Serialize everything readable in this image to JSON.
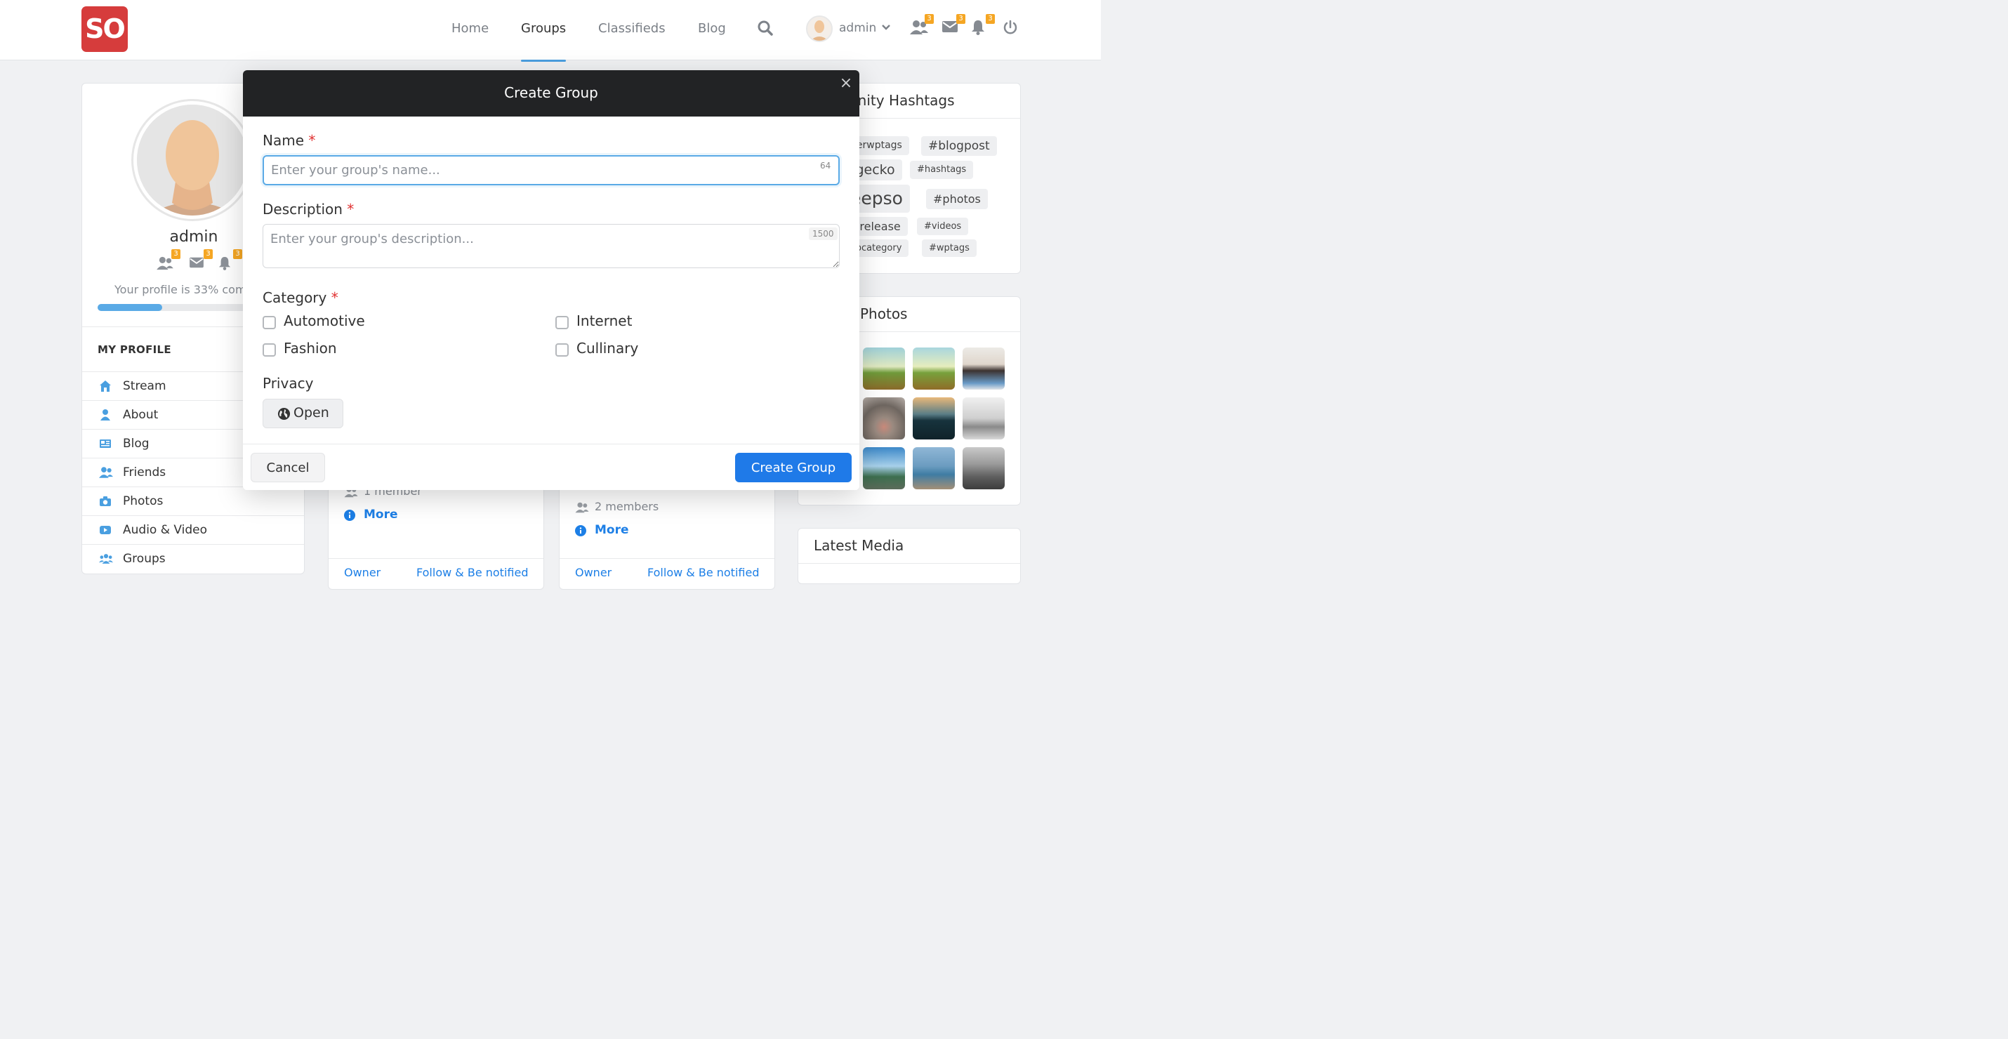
{
  "header": {
    "logo_text": "SO",
    "nav": [
      "Home",
      "Groups",
      "Classifieds",
      "Blog"
    ],
    "active_nav": "Groups",
    "username": "admin",
    "badges": {
      "friends": "3",
      "messages": "3",
      "notifications": "3"
    }
  },
  "profile": {
    "name": "admin",
    "badges": {
      "friends": "3",
      "messages": "3",
      "notifications": "3"
    },
    "completion_text": "Your profile is 33% com",
    "completion_percent": 33,
    "section_title": "MY PROFILE",
    "menu": [
      "Stream",
      "About",
      "Blog",
      "Friends",
      "Photos",
      "Audio & Video",
      "Groups"
    ]
  },
  "group_cards": [
    {
      "members": "1 member",
      "more": "More",
      "action_owner": "Owner",
      "action_follow": "Follow & Be notified"
    },
    {
      "members": "2 members",
      "more": "More",
      "action_owner": "Owner",
      "action_follow": "Follow & Be notified"
    }
  ],
  "hashtags": {
    "title": "unity Hashtags",
    "tags": [
      "herwptags",
      "#blogpost",
      "rgecko",
      "#hashtags",
      "eepso",
      "#photos",
      "#release",
      "#videos",
      "vpcategory",
      "#wptags"
    ]
  },
  "photos": {
    "title": "Photos"
  },
  "latest_media": {
    "title": "Latest Media"
  },
  "modal": {
    "title": "Create Group",
    "close": "×",
    "name_label": "Name",
    "name_placeholder": "Enter your group's name...",
    "name_limit": "64",
    "desc_label": "Description",
    "desc_placeholder": "Enter your group's description...",
    "desc_limit": "1500",
    "required_mark": "*",
    "category_label": "Category",
    "categories": [
      "Automotive",
      "Internet",
      "Fashion",
      "Cullinary"
    ],
    "privacy_label": "Privacy",
    "privacy_value": "Open",
    "cancel_label": "Cancel",
    "create_label": "Create Group"
  },
  "colors": {
    "brand": "#d63c3c",
    "accent": "#1f7ae8",
    "badge": "#f5a623",
    "modal_header": "#222325"
  }
}
